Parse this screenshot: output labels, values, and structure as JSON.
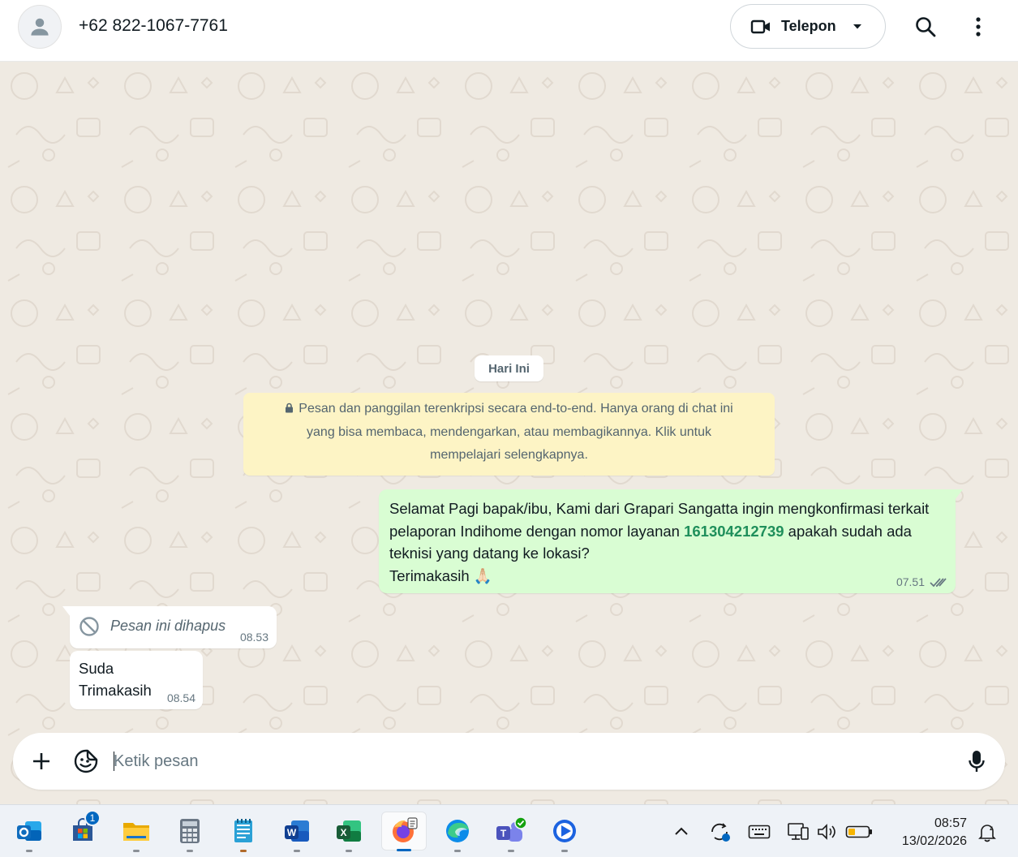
{
  "header": {
    "contact_name": "+62 822-1067-7761",
    "call_label": "Telepon",
    "avatar_icon": "person-icon",
    "call_icon": "video-camera-icon",
    "icons": [
      "search-icon",
      "more-vertical-icon"
    ]
  },
  "chat": {
    "day_label": "Hari Ini",
    "e2e_notice": "Pesan dan panggilan terenkripsi secara end-to-end. Hanya orang di chat ini yang bisa membaca, mendengarkan, atau membagikannya. Klik untuk mempelajari selengkapnya.",
    "messages": [
      {
        "direction": "outgoing",
        "text_before": "Selamat Pagi bapak/ibu, Kami dari Grapari Sangatta ingin mengkonfirmasi terkait pelaporan Indihome dengan nomor layanan ",
        "number": "161304212739",
        "text_after": " apakah sudah ada teknisi yang datang ke lokasi?\nTerimakasih 🙏🏻",
        "time": "07.51",
        "status_icon": "double-check-icon"
      },
      {
        "direction": "incoming",
        "deleted": true,
        "text": "Pesan ini dihapus",
        "time": "08.53"
      },
      {
        "direction": "incoming",
        "text": "Suda\nTrimakasih",
        "time": "08.54"
      }
    ]
  },
  "composer": {
    "placeholder": "Ketik pesan",
    "value": "",
    "icons": [
      "plus-icon",
      "sticker-icon",
      "microphone-icon"
    ]
  },
  "taskbar": {
    "apps": [
      {
        "name": "outlook-app"
      },
      {
        "name": "microsoft-store-app",
        "badge": "1"
      },
      {
        "name": "file-explorer-app"
      },
      {
        "name": "calculator-app"
      },
      {
        "name": "notepad-app"
      },
      {
        "name": "word-app"
      },
      {
        "name": "excel-app"
      },
      {
        "name": "firefox-app",
        "active": true
      },
      {
        "name": "edge-app"
      },
      {
        "name": "teams-app"
      },
      {
        "name": "media-player-app"
      }
    ],
    "time": "08:57",
    "date": "13/02/2026"
  },
  "colors": {
    "chat_background": "#efeae2",
    "outgoing_bubble": "#d9fdd3",
    "incoming_bubble": "#ffffff",
    "notice_background": "#fdf4c5",
    "accent_number": "#1f8f5b"
  }
}
